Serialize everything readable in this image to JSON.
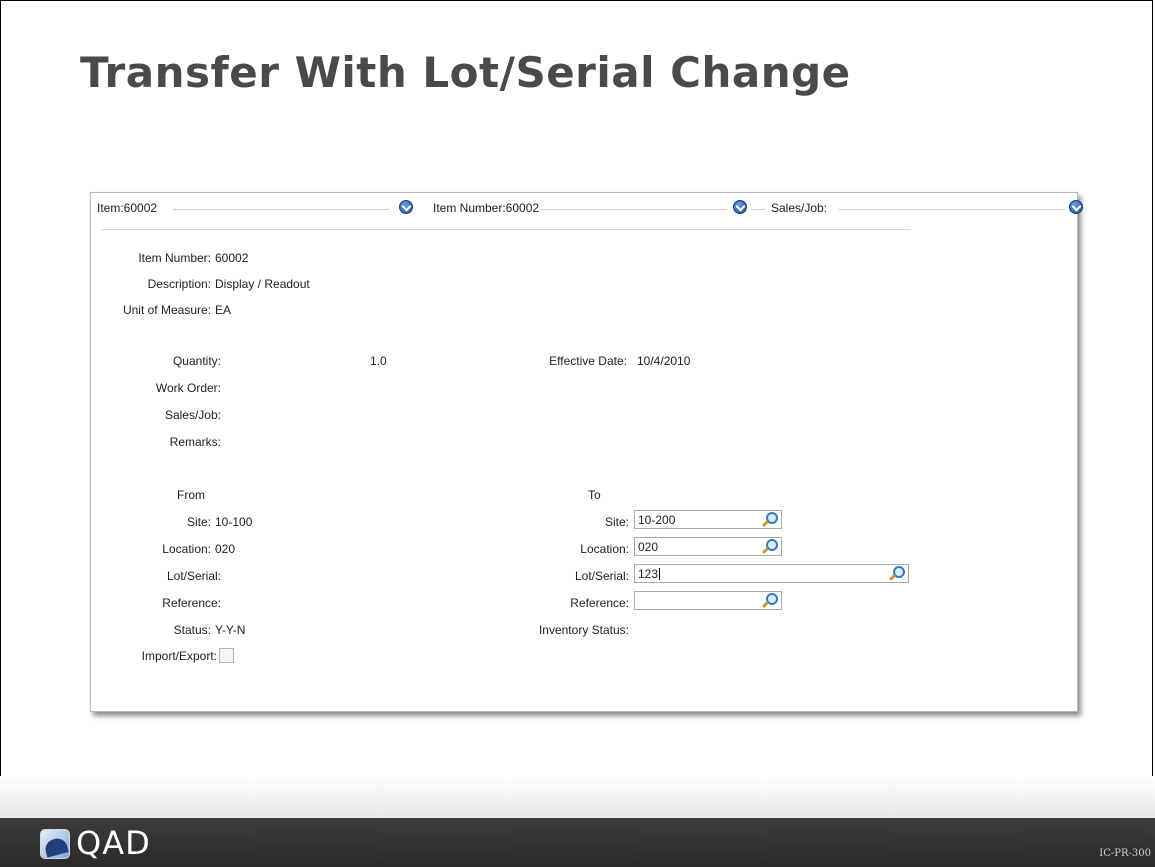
{
  "slide": {
    "title": "Transfer With Lot/Serial Change",
    "brand": "QAD",
    "code": "IC-PR-300"
  },
  "header": {
    "item": "Item:60002",
    "item_number": "Item Number:60002",
    "sales_job": "Sales/Job:"
  },
  "item": {
    "number_label": "Item Number:",
    "number_value": "60002",
    "description_label": "Description:",
    "description_value": "Display / Readout",
    "uom_label": "Unit of Measure:",
    "uom_value": "EA"
  },
  "details": {
    "quantity_label": "Quantity:",
    "quantity_value": "1.0",
    "effective_date_label": "Effective Date:",
    "effective_date_value": "10/4/2010",
    "work_order_label": "Work Order:",
    "sales_job_label": "Sales/Job:",
    "remarks_label": "Remarks:"
  },
  "from": {
    "heading": "From",
    "site_label": "Site:",
    "site_value": "10-100",
    "location_label": "Location:",
    "location_value": "020",
    "lot_serial_label": "Lot/Serial:",
    "reference_label": "Reference:",
    "status_label": "Status:",
    "status_value": "Y-Y-N",
    "import_export_label": "Import/Export:"
  },
  "to": {
    "heading": "To",
    "site_label": "Site:",
    "site_value": "10-200",
    "location_label": "Location:",
    "location_value": "020",
    "lot_serial_label": "Lot/Serial:",
    "lot_serial_value": "123",
    "reference_label": "Reference:",
    "reference_value": "",
    "inventory_status_label": "Inventory Status:"
  },
  "icons": {
    "dropdown": "chevron-down-circle-icon",
    "lookup": "magnifier-lookup-icon",
    "logo": "qad-logo-icon"
  }
}
